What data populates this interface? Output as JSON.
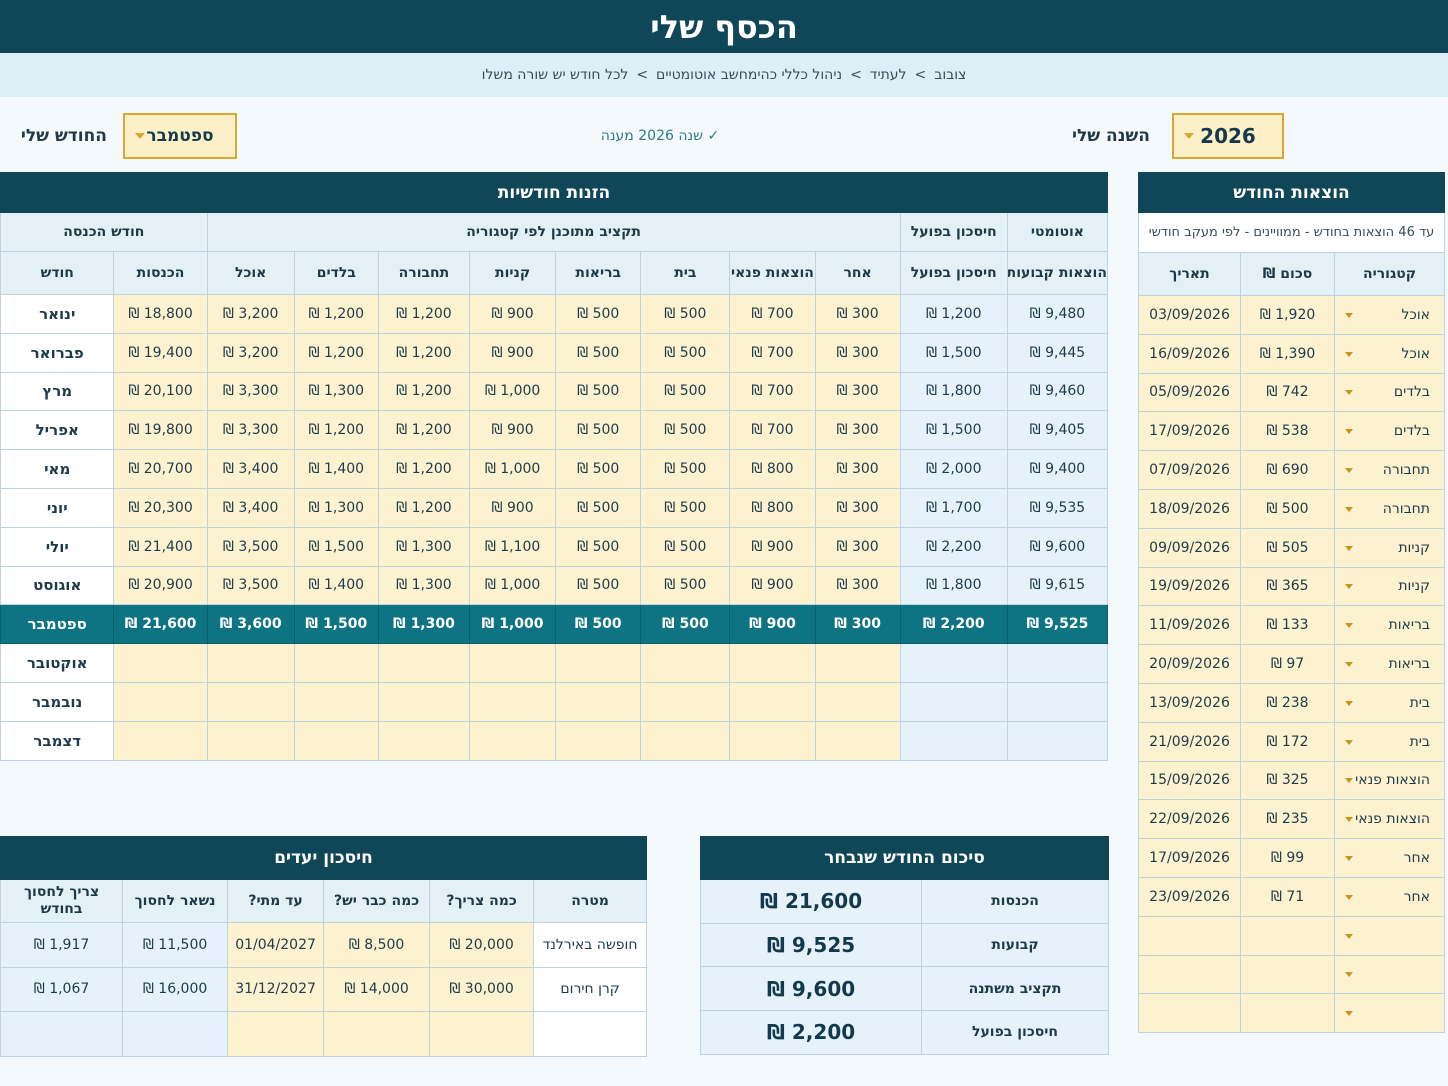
{
  "title": "הכסף שלי",
  "breadcrumb": [
    "צובוב",
    "לעתיד",
    "ניהול כללי כהימחשב אוטומטיים",
    "לכל חודש יש שורה משלו"
  ],
  "year": {
    "label": "השנה שלי",
    "value": "2026"
  },
  "month": {
    "label": "החודש שלי",
    "value": "ספטמבר"
  },
  "status_note": "✓ שנה 2026 מענה",
  "monthly": {
    "title": "הזנות חודשיות",
    "group_headers": {
      "auto": "אוטומטי",
      "savings": "חיסכון בפועל",
      "budget": "תקציב מתוכנן לפי קטגוריה",
      "income_month": "חודש הכנסה"
    },
    "columns": [
      "הוצאות קבועות",
      "חיסכון בפועל",
      "אחר",
      "הוצאות פנאי",
      "בית",
      "בריאות",
      "קניות",
      "תחבורה",
      "בלדים",
      "אוכל",
      "הכנסות",
      "חודש"
    ],
    "rows": [
      {
        "fixed": "9,480 ₪",
        "savings": "1,200 ₪",
        "other": "300 ₪",
        "leisure": "700 ₪",
        "home": "500 ₪",
        "health": "500 ₪",
        "shopping": "900 ₪",
        "transport": "1,200 ₪",
        "kids": "1,200 ₪",
        "food": "3,200 ₪",
        "income": "18,800 ₪",
        "month": "ינואר"
      },
      {
        "fixed": "9,445 ₪",
        "savings": "1,500 ₪",
        "other": "300 ₪",
        "leisure": "700 ₪",
        "home": "500 ₪",
        "health": "500 ₪",
        "shopping": "900 ₪",
        "transport": "1,200 ₪",
        "kids": "1,200 ₪",
        "food": "3,200 ₪",
        "income": "19,400 ₪",
        "month": "פברואר"
      },
      {
        "fixed": "9,460 ₪",
        "savings": "1,800 ₪",
        "other": "300 ₪",
        "leisure": "700 ₪",
        "home": "500 ₪",
        "health": "500 ₪",
        "shopping": "1,000 ₪",
        "transport": "1,200 ₪",
        "kids": "1,300 ₪",
        "food": "3,300 ₪",
        "income": "20,100 ₪",
        "month": "מרץ"
      },
      {
        "fixed": "9,405 ₪",
        "savings": "1,500 ₪",
        "other": "300 ₪",
        "leisure": "700 ₪",
        "home": "500 ₪",
        "health": "500 ₪",
        "shopping": "900 ₪",
        "transport": "1,200 ₪",
        "kids": "1,200 ₪",
        "food": "3,300 ₪",
        "income": "19,800 ₪",
        "month": "אפריל"
      },
      {
        "fixed": "9,400 ₪",
        "savings": "2,000 ₪",
        "other": "300 ₪",
        "leisure": "800 ₪",
        "home": "500 ₪",
        "health": "500 ₪",
        "shopping": "1,000 ₪",
        "transport": "1,200 ₪",
        "kids": "1,400 ₪",
        "food": "3,400 ₪",
        "income": "20,700 ₪",
        "month": "מאי"
      },
      {
        "fixed": "9,535 ₪",
        "savings": "1,700 ₪",
        "other": "300 ₪",
        "leisure": "800 ₪",
        "home": "500 ₪",
        "health": "500 ₪",
        "shopping": "900 ₪",
        "transport": "1,200 ₪",
        "kids": "1,300 ₪",
        "food": "3,400 ₪",
        "income": "20,300 ₪",
        "month": "יוני"
      },
      {
        "fixed": "9,600 ₪",
        "savings": "2,200 ₪",
        "other": "300 ₪",
        "leisure": "900 ₪",
        "home": "500 ₪",
        "health": "500 ₪",
        "shopping": "1,100 ₪",
        "transport": "1,300 ₪",
        "kids": "1,500 ₪",
        "food": "3,500 ₪",
        "income": "21,400 ₪",
        "month": "יולי"
      },
      {
        "fixed": "9,615 ₪",
        "savings": "1,800 ₪",
        "other": "300 ₪",
        "leisure": "900 ₪",
        "home": "500 ₪",
        "health": "500 ₪",
        "shopping": "1,000 ₪",
        "transport": "1,300 ₪",
        "kids": "1,400 ₪",
        "food": "3,500 ₪",
        "income": "20,900 ₪",
        "month": "אוגוסט"
      },
      {
        "fixed": "9,525 ₪",
        "savings": "2,200 ₪",
        "other": "300 ₪",
        "leisure": "900 ₪",
        "home": "500 ₪",
        "health": "500 ₪",
        "shopping": "1,000 ₪",
        "transport": "1,300 ₪",
        "kids": "1,500 ₪",
        "food": "3,600 ₪",
        "income": "21,600 ₪",
        "month": "ספטמבר"
      },
      {
        "fixed": "",
        "savings": "",
        "other": "",
        "leisure": "",
        "home": "",
        "health": "",
        "shopping": "",
        "transport": "",
        "kids": "",
        "food": "",
        "income": "",
        "month": "אוקטובר"
      },
      {
        "fixed": "",
        "savings": "",
        "other": "",
        "leisure": "",
        "home": "",
        "health": "",
        "shopping": "",
        "transport": "",
        "kids": "",
        "food": "",
        "income": "",
        "month": "נובמבר"
      },
      {
        "fixed": "",
        "savings": "",
        "other": "",
        "leisure": "",
        "home": "",
        "health": "",
        "shopping": "",
        "transport": "",
        "kids": "",
        "food": "",
        "income": "",
        "month": "דצמבר"
      }
    ],
    "selected_month": "ספטמבר"
  },
  "expenses": {
    "title": "הוצאות החודש",
    "note": "עד 46 הוצאות בחודש - ממוויינים - לפי מעקב חודשי",
    "columns": [
      "קטגוריה",
      "סכום ₪",
      "תאריך"
    ],
    "rows": [
      {
        "category": "אוכל",
        "amount": "1,920 ₪",
        "date": "03/09/2026"
      },
      {
        "category": "אוכל",
        "amount": "1,390 ₪",
        "date": "16/09/2026"
      },
      {
        "category": "בלדים",
        "amount": "742 ₪",
        "date": "05/09/2026"
      },
      {
        "category": "בלדים",
        "amount": "538 ₪",
        "date": "17/09/2026"
      },
      {
        "category": "תחבורה",
        "amount": "690 ₪",
        "date": "07/09/2026"
      },
      {
        "category": "תחבורה",
        "amount": "500 ₪",
        "date": "18/09/2026"
      },
      {
        "category": "קניות",
        "amount": "505 ₪",
        "date": "09/09/2026"
      },
      {
        "category": "קניות",
        "amount": "365 ₪",
        "date": "19/09/2026"
      },
      {
        "category": "בריאות",
        "amount": "133 ₪",
        "date": "11/09/2026"
      },
      {
        "category": "בריאות",
        "amount": "97 ₪",
        "date": "20/09/2026"
      },
      {
        "category": "בית",
        "amount": "238 ₪",
        "date": "13/09/2026"
      },
      {
        "category": "בית",
        "amount": "172 ₪",
        "date": "21/09/2026"
      },
      {
        "category": "הוצאות פנאי",
        "amount": "325 ₪",
        "date": "15/09/2026"
      },
      {
        "category": "הוצאות פנאי",
        "amount": "235 ₪",
        "date": "22/09/2026"
      },
      {
        "category": "אחר",
        "amount": "99 ₪",
        "date": "17/09/2026"
      },
      {
        "category": "אחר",
        "amount": "71 ₪",
        "date": "23/09/2026"
      },
      {
        "category": "",
        "amount": "",
        "date": ""
      },
      {
        "category": "",
        "amount": "",
        "date": ""
      },
      {
        "category": "",
        "amount": "",
        "date": ""
      }
    ]
  },
  "summary": {
    "title": "סיכום החודש שנבחר",
    "rows": [
      {
        "label": "הכנסות",
        "value": "21,600 ₪"
      },
      {
        "label": "קבועות",
        "value": "9,525 ₪"
      },
      {
        "label": "תקציב משתנה",
        "value": "9,600 ₪"
      },
      {
        "label": "חיסכון בפועל",
        "value": "2,200 ₪"
      }
    ]
  },
  "goals": {
    "title": "חיסכון יעדים",
    "columns": [
      "מטרה",
      "כמה צריך?",
      "כמה כבר יש?",
      "עד מתי?",
      "נשאר לחסוך",
      "צריך לחסוך בחודש"
    ],
    "rows": [
      {
        "goal": "חופשה באירלנד",
        "need": "20,000 ₪",
        "have": "8,500 ₪",
        "until": "01/04/2027",
        "left": "11,500 ₪",
        "monthly": "1,917 ₪"
      },
      {
        "goal": "קרן חירום",
        "need": "30,000 ₪",
        "have": "14,000 ₪",
        "until": "31/12/2027",
        "left": "16,000 ₪",
        "monthly": "1,067 ₪"
      },
      {
        "goal": "",
        "need": "",
        "have": "",
        "until": "",
        "left": "",
        "monthly": ""
      }
    ]
  }
}
